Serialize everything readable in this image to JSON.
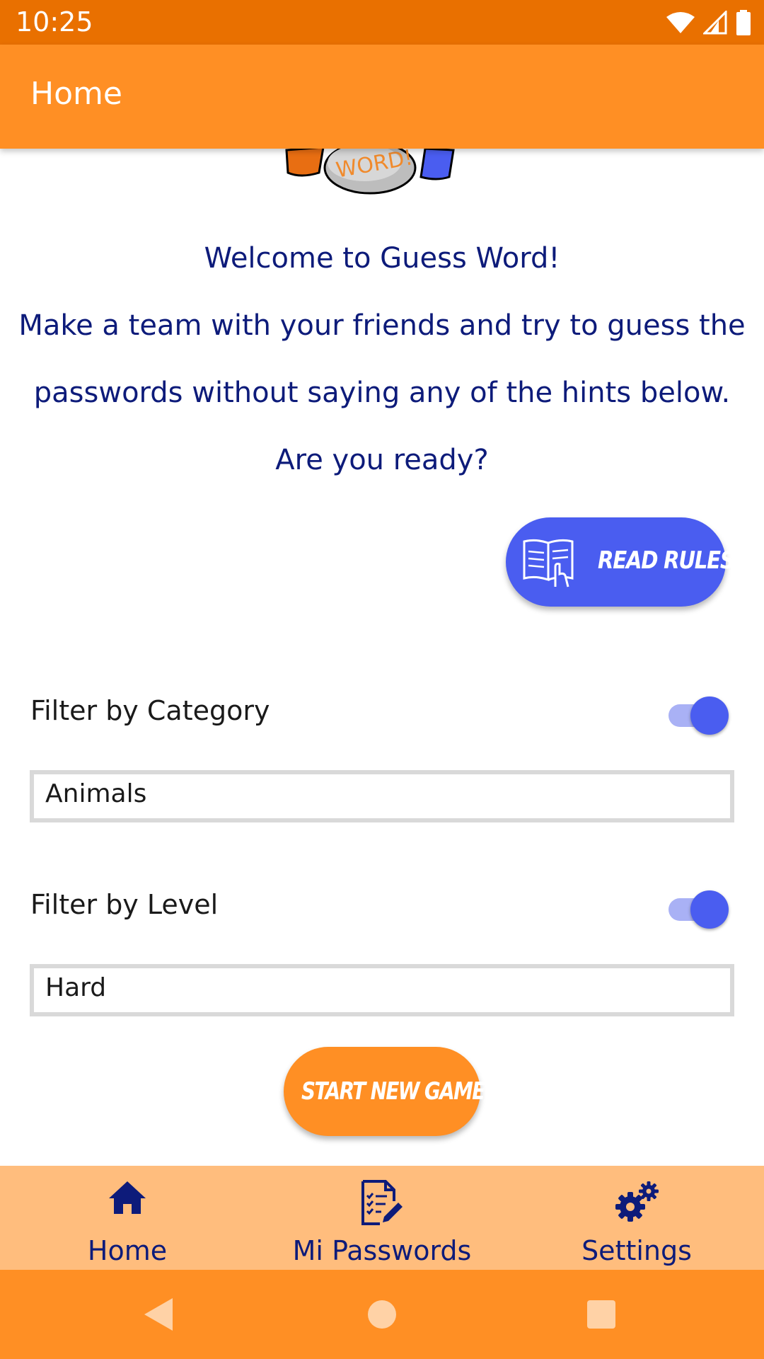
{
  "status_bar": {
    "time": "10:25"
  },
  "app_bar": {
    "title": "Home"
  },
  "logo": {
    "text": "WORD!"
  },
  "welcome": {
    "line1": "Welcome to Guess Word!",
    "line2": "Make a team with your friends and try to guess the",
    "line3": "passwords without saying any of the hints below.",
    "line4": "Are you ready?"
  },
  "read_rules": {
    "label": "READ RULES"
  },
  "filters": {
    "category": {
      "label": "Filter by Category",
      "enabled": true,
      "selected": "Animals"
    },
    "level": {
      "label": "Filter by Level",
      "enabled": true,
      "selected": "Hard"
    }
  },
  "start_button": {
    "label": "START NEW GAME"
  },
  "bottom_nav": {
    "items": [
      {
        "label": "Home",
        "icon": "home-icon"
      },
      {
        "label": "Mi Passwords",
        "icon": "passwords-list-icon"
      },
      {
        "label": "Settings",
        "icon": "gears-icon"
      }
    ]
  },
  "colors": {
    "status_bar": "#E97000",
    "app_bar": "#FF8F24",
    "accent_blue": "#4A5DF0",
    "text_navy": "#0D1B7A",
    "bottom_nav": "#FFBD7D"
  }
}
